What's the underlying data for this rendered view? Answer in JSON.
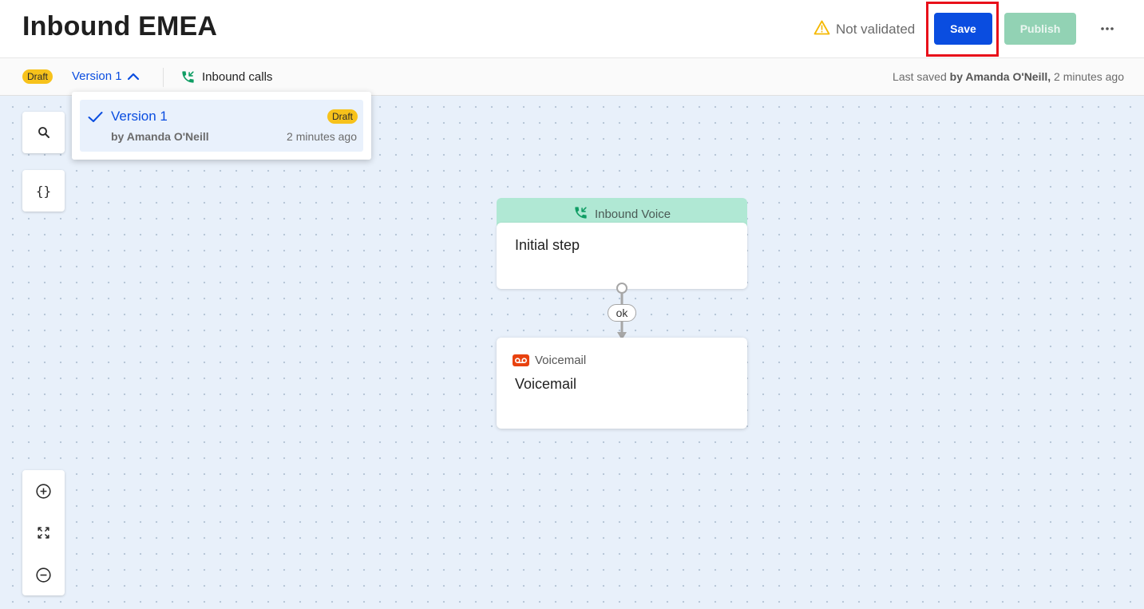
{
  "header": {
    "title": "Inbound EMEA",
    "validation_text": "Not validated",
    "save_label": "Save",
    "publish_label": "Publish",
    "more_icon": "more-horizontal-icon"
  },
  "subheader": {
    "status_badge": "Draft",
    "version_label": "Version 1",
    "channel_label": "Inbound calls",
    "last_saved_prefix": "Last saved",
    "last_saved_by": "by Amanda O'Neill,",
    "last_saved_time": "2 minutes ago"
  },
  "version_dropdown": {
    "items": [
      {
        "name": "Version 1",
        "badge": "Draft",
        "author": "by Amanda O'Neill",
        "time": "2 minutes ago",
        "selected": true
      }
    ]
  },
  "toolbar": {
    "search_icon": "search-icon",
    "variables_label": "{}",
    "zoom_in_icon": "zoom-in-icon",
    "fit_icon": "fit-screen-icon",
    "zoom_out_icon": "zoom-out-icon"
  },
  "flow": {
    "start_node": {
      "header": "Inbound Voice",
      "title": "Initial step"
    },
    "edge_label": "ok",
    "voicemail_node": {
      "type": "Voicemail",
      "title": "Voicemail"
    }
  },
  "colors": {
    "primary": "#0a4de0",
    "publish_disabled": "#92d2b4",
    "draft_badge": "#f7c21b",
    "warning": "#f5b800",
    "voicemail_icon": "#e8420f",
    "inbound_header": "#b0e8d4",
    "highlight_border": "#e8101a"
  }
}
